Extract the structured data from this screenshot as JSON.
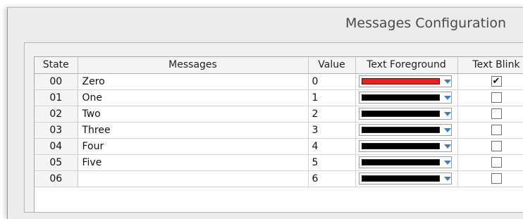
{
  "window": {
    "title": "Messages Configuration"
  },
  "table": {
    "columns": [
      "State",
      "Messages",
      "Value",
      "Text Foreground",
      "Text Blink"
    ],
    "rows": [
      {
        "state": "00",
        "message": "Zero",
        "value": "0",
        "fg_color": "#e8201e",
        "blink": true
      },
      {
        "state": "01",
        "message": "One",
        "value": "1",
        "fg_color": "#000000",
        "blink": false
      },
      {
        "state": "02",
        "message": "Two",
        "value": "2",
        "fg_color": "#000000",
        "blink": false
      },
      {
        "state": "03",
        "message": "Three",
        "value": "3",
        "fg_color": "#000000",
        "blink": false
      },
      {
        "state": "04",
        "message": "Four",
        "value": "4",
        "fg_color": "#000000",
        "blink": false
      },
      {
        "state": "05",
        "message": "Five",
        "value": "5",
        "fg_color": "#000000",
        "blink": false
      },
      {
        "state": "06",
        "message": "",
        "value": "6",
        "fg_color": "#000000",
        "blink": false
      }
    ]
  },
  "icons": {
    "dropdown": "chevron-down-icon",
    "checkmark": "check-icon"
  },
  "colors": {
    "dropdown_arrow": "#3a7fc4",
    "red_swatch": "#e8201e",
    "black_swatch": "#000000"
  }
}
